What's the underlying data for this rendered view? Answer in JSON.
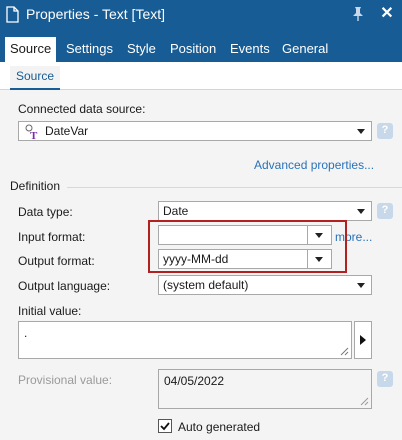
{
  "window": {
    "title": "Properties - Text [Text]",
    "doc_icon": "document-icon",
    "pin_icon": "pin-icon",
    "close_label": "✕"
  },
  "tabs": [
    {
      "label": "Source",
      "active": true
    },
    {
      "label": "Settings",
      "active": false
    },
    {
      "label": "Style",
      "active": false
    },
    {
      "label": "Position",
      "active": false
    },
    {
      "label": "Events",
      "active": false
    },
    {
      "label": "General",
      "active": false
    }
  ],
  "subtab": {
    "label": "Source"
  },
  "connected_source": {
    "label": "Connected data source:",
    "value": "DateVar",
    "icon": "variable-icon"
  },
  "advanced_link": "Advanced properties...",
  "definition_header": "Definition",
  "data_type": {
    "label": "Data type:",
    "value": "Date"
  },
  "input_format": {
    "label": "Input format:",
    "value": "",
    "more": "more..."
  },
  "output_format": {
    "label": "Output format:",
    "value": "yyyy-MM-dd"
  },
  "output_language": {
    "label": "Output language:",
    "value": "(system default)"
  },
  "initial_value": {
    "label": "Initial value:",
    "value": "."
  },
  "provisional_value": {
    "label": "Provisional value:",
    "value": "04/05/2022"
  },
  "auto_generated": {
    "label": "Auto generated",
    "checked": true
  },
  "help_glyph": "?",
  "colors": {
    "titlebar": "#175c94",
    "highlight": "#b32020",
    "link": "#2a72b8"
  }
}
